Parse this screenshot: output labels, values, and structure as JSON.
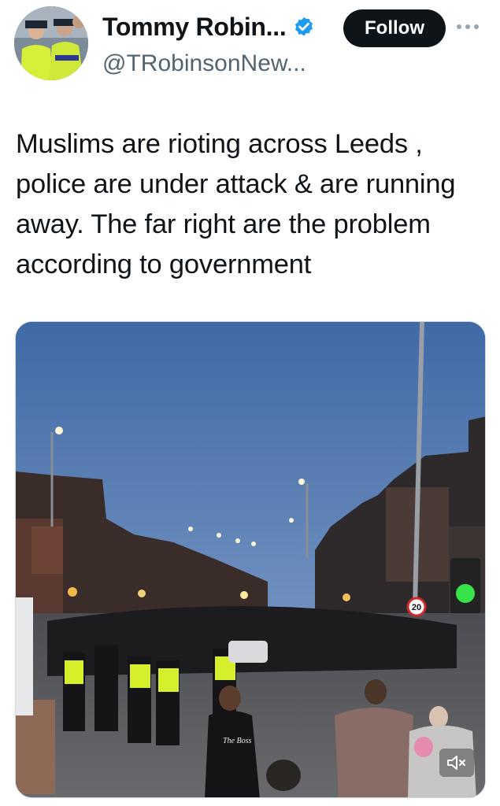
{
  "header": {
    "display_name": "Tommy Robin...",
    "handle": "@TRobinsonNew...",
    "follow_label": "Follow"
  },
  "tweet": {
    "text": "Muslims are rioting across Leeds , police are under attack & are running away. The far right are the problem according to government"
  },
  "media": {
    "type": "video",
    "shirt_text": "The Boss",
    "speed_sign": "20"
  },
  "icons": {
    "verified": "verified-badge-icon",
    "more": "more-options-icon",
    "mute": "volume-muted-icon"
  },
  "colors": {
    "verified_blue": "#1d9bf0",
    "follow_bg": "#0f1419",
    "text_secondary": "#536471"
  }
}
